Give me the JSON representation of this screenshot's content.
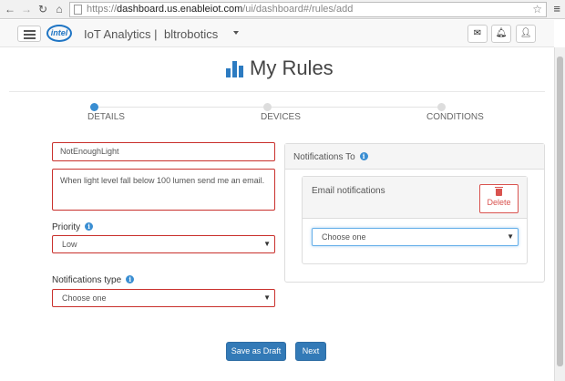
{
  "browser": {
    "url_prefix": "https://",
    "url_host": "dashboard.us.enableiot.com",
    "url_path": "/ui/dashboard#/rules/add"
  },
  "header": {
    "logo_text": "intel",
    "app_title": "IoT Analytics |",
    "account_name": "bltrobotics"
  },
  "page": {
    "title": "My Rules"
  },
  "steps": [
    {
      "label": "DETAILS",
      "active": true
    },
    {
      "label": "DEVICES",
      "active": false
    },
    {
      "label": "CONDITIONS",
      "active": false
    }
  ],
  "form": {
    "rule_name": "NotEnoughLight",
    "description": "When light level fall below 100 lumen send me an email.",
    "priority_label": "Priority",
    "priority_value": "Low",
    "notif_type_label": "Notifications type",
    "notif_type_value": "Choose one"
  },
  "notifications": {
    "heading": "Notifications To",
    "item_title": "Email notifications",
    "delete_label": "Delete",
    "select_value": "Choose one"
  },
  "actions": {
    "save_draft": "Save as Draft",
    "next": "Next"
  },
  "colors": {
    "primary": "#337ab7",
    "danger": "#c9302c",
    "accent": "#3a8ed2"
  }
}
